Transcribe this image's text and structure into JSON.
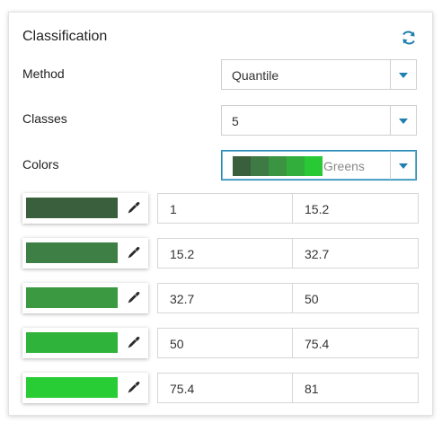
{
  "panel": {
    "title": "Classification"
  },
  "method": {
    "label": "Method",
    "value": "Quantile"
  },
  "classes": {
    "label": "Classes",
    "value": "5"
  },
  "colors": {
    "label": "Colors",
    "ramp_name": "Greens",
    "ramp": [
      "#3a5f3c",
      "#3d7a44",
      "#3b9441",
      "#32ae3c",
      "#28c935"
    ]
  },
  "class_rows": [
    {
      "color": "#3a5f3c",
      "min": "1",
      "max": "15.2"
    },
    {
      "color": "#3d7f45",
      "min": "15.2",
      "max": "32.7"
    },
    {
      "color": "#3b9a41",
      "min": "32.7",
      "max": "50"
    },
    {
      "color": "#30b33b",
      "min": "50",
      "max": "75.4"
    },
    {
      "color": "#28cc34",
      "min": "75.4",
      "max": "81"
    }
  ],
  "accent": "#1e7fb0"
}
